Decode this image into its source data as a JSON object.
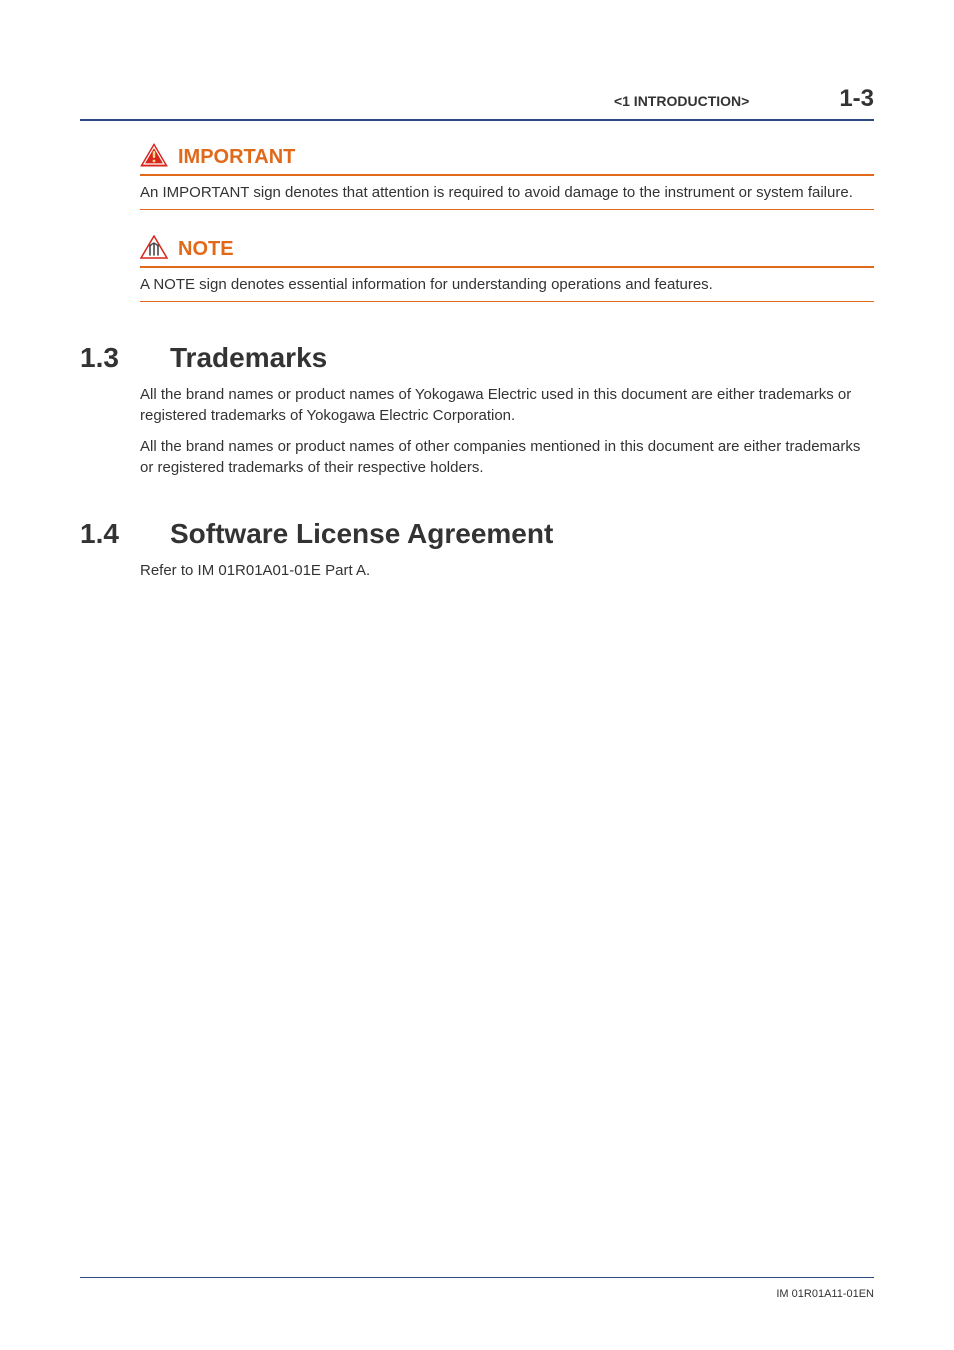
{
  "header": {
    "breadcrumb": "<1 INTRODUCTION>",
    "page_number": "1-3"
  },
  "important": {
    "label": "IMPORTANT",
    "body": "An IMPORTANT sign denotes that attention is required to avoid damage to the instrument or system failure."
  },
  "note": {
    "label": "NOTE",
    "body": "A NOTE sign denotes essential information for understanding operations and features."
  },
  "sections": {
    "trademarks": {
      "number": "1.3",
      "title": "Trademarks",
      "p1": "All the brand names or product names of Yokogawa Electric used in this document are either trademarks or registered trademarks of Yokogawa Electric Corporation.",
      "p2": "All the brand names or product names of other companies mentioned in this document are either trademarks or registered trademarks of their respective holders."
    },
    "software": {
      "number": "1.4",
      "title": "Software License Agreement",
      "p1": "Refer to IM 01R01A01-01E Part A."
    }
  },
  "footer": {
    "doc_id": "IM 01R01A11-01EN"
  }
}
